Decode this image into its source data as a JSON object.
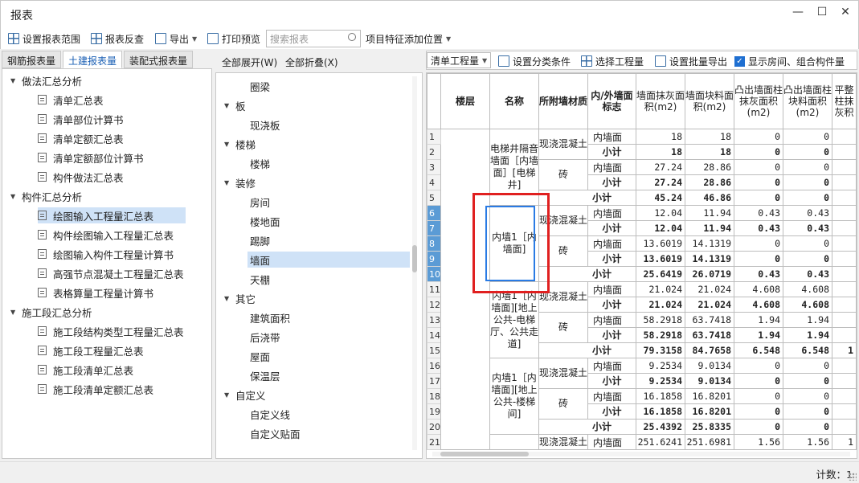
{
  "window": {
    "title": "报表",
    "min": "—",
    "max": "☐",
    "close": "✕"
  },
  "toolbar": {
    "set_range": "设置报表范围",
    "report_reverse": "报表反查",
    "export": "导出",
    "print_preview": "打印预览",
    "search_placeholder": "搜索报表",
    "feature_position": "项目特征添加位置"
  },
  "tabs": [
    "钢筋报表量",
    "土建报表量",
    "装配式报表量"
  ],
  "left_tree": [
    {
      "label": "做法汇总分析",
      "group": true
    },
    {
      "label": "清单汇总表"
    },
    {
      "label": "清单部位计算书"
    },
    {
      "label": "清单定额汇总表"
    },
    {
      "label": "清单定额部位计算书"
    },
    {
      "label": "构件做法汇总表"
    },
    {
      "label": "构件汇总分析",
      "group": true
    },
    {
      "label": "绘图输入工程量汇总表",
      "selected": true
    },
    {
      "label": "构件绘图输入工程量汇总表"
    },
    {
      "label": "绘图输入构件工程量计算书"
    },
    {
      "label": "高强节点混凝土工程量汇总表"
    },
    {
      "label": "表格算量工程量计算书"
    },
    {
      "label": "施工段汇总分析",
      "group": true
    },
    {
      "label": "施工段结构类型工程量汇总表"
    },
    {
      "label": "施工段工程量汇总表"
    },
    {
      "label": "施工段清单汇总表"
    },
    {
      "label": "施工段清单定额汇总表"
    }
  ],
  "mid_bar": {
    "expand_all": "全部展开(W)",
    "collapse_all": "全部折叠(X)"
  },
  "mid_tree": [
    {
      "label": "圈梁"
    },
    {
      "label": "板",
      "group": true
    },
    {
      "label": "现浇板"
    },
    {
      "label": "楼梯",
      "group": true
    },
    {
      "label": "楼梯"
    },
    {
      "label": "装修",
      "group": true
    },
    {
      "label": "房间"
    },
    {
      "label": "楼地面"
    },
    {
      "label": "踢脚"
    },
    {
      "label": "墙面",
      "selected": true
    },
    {
      "label": "天棚"
    },
    {
      "label": "其它",
      "group": true
    },
    {
      "label": "建筑面积"
    },
    {
      "label": "后浇带"
    },
    {
      "label": "屋面"
    },
    {
      "label": "保温层"
    },
    {
      "label": "自定义",
      "group": true
    },
    {
      "label": "自定义线"
    },
    {
      "label": "自定义贴面"
    }
  ],
  "right_bar": {
    "dropdown": "清单工程量",
    "set_category": "设置分类条件",
    "choose_qty": "选择工程量",
    "set_batch_export": "设置批量导出",
    "show_room": "显示房间、组合构件量"
  },
  "table": {
    "headers": [
      "楼层",
      "名称",
      "所附墙材质",
      "内/外墙面标志",
      "墙面抹灰面积(m2)",
      "墙面块料面积(m2)",
      "凸出墙面柱抹灰面积(m2)",
      "凸出墙面柱块料面积(m2)",
      "平整柱抹灰积"
    ],
    "names": [
      "电梯井隔音墙面［内墙面］[电梯井]",
      "内墙1［内墙面]",
      "内墙1［内墙面][地上公共-电梯厅、公共走道]",
      "内墙1［内墙面][地上公共-楼梯间]"
    ],
    "materials": [
      "现浇混凝土",
      "砖"
    ],
    "labels": {
      "inner": "内墙面",
      "subtotal": "小计"
    },
    "rows": [
      [
        "1",
        "18",
        "18",
        "0",
        "0"
      ],
      [
        "2",
        "18",
        "18",
        "0",
        "0"
      ],
      [
        "3",
        "27.24",
        "28.86",
        "0",
        "0"
      ],
      [
        "4",
        "27.24",
        "28.86",
        "0",
        "0"
      ],
      [
        "5",
        "45.24",
        "46.86",
        "0",
        "0"
      ],
      [
        "6",
        "12.04",
        "11.94",
        "0.43",
        "0.43"
      ],
      [
        "7",
        "12.04",
        "11.94",
        "0.43",
        "0.43"
      ],
      [
        "8",
        "13.6019",
        "14.1319",
        "0",
        "0"
      ],
      [
        "9",
        "13.6019",
        "14.1319",
        "0",
        "0"
      ],
      [
        "10",
        "25.6419",
        "26.0719",
        "0.43",
        "0.43"
      ],
      [
        "11",
        "21.024",
        "21.024",
        "4.608",
        "4.608"
      ],
      [
        "12",
        "21.024",
        "21.024",
        "4.608",
        "4.608"
      ],
      [
        "13",
        "58.2918",
        "63.7418",
        "1.94",
        "1.94"
      ],
      [
        "14",
        "58.2918",
        "63.7418",
        "1.94",
        "1.94"
      ],
      [
        "15",
        "79.3158",
        "84.7658",
        "6.548",
        "6.548"
      ],
      [
        "16",
        "9.2534",
        "9.0134",
        "0",
        "0"
      ],
      [
        "17",
        "9.2534",
        "9.0134",
        "0",
        "0"
      ],
      [
        "18",
        "16.1858",
        "16.8201",
        "0",
        "0"
      ],
      [
        "19",
        "16.1858",
        "16.8201",
        "0",
        "0"
      ],
      [
        "20",
        "25.4392",
        "25.8335",
        "0",
        "0"
      ],
      [
        "21",
        "251.6241",
        "251.6981",
        "1.56",
        "1.56"
      ]
    ],
    "extra_col": [
      "",
      "",
      "",
      "",
      "",
      "",
      "",
      "",
      "",
      "",
      "",
      "",
      "",
      "",
      "1",
      "",
      "",
      "",
      "",
      "",
      "1"
    ]
  },
  "status": {
    "count": "计数：1"
  }
}
